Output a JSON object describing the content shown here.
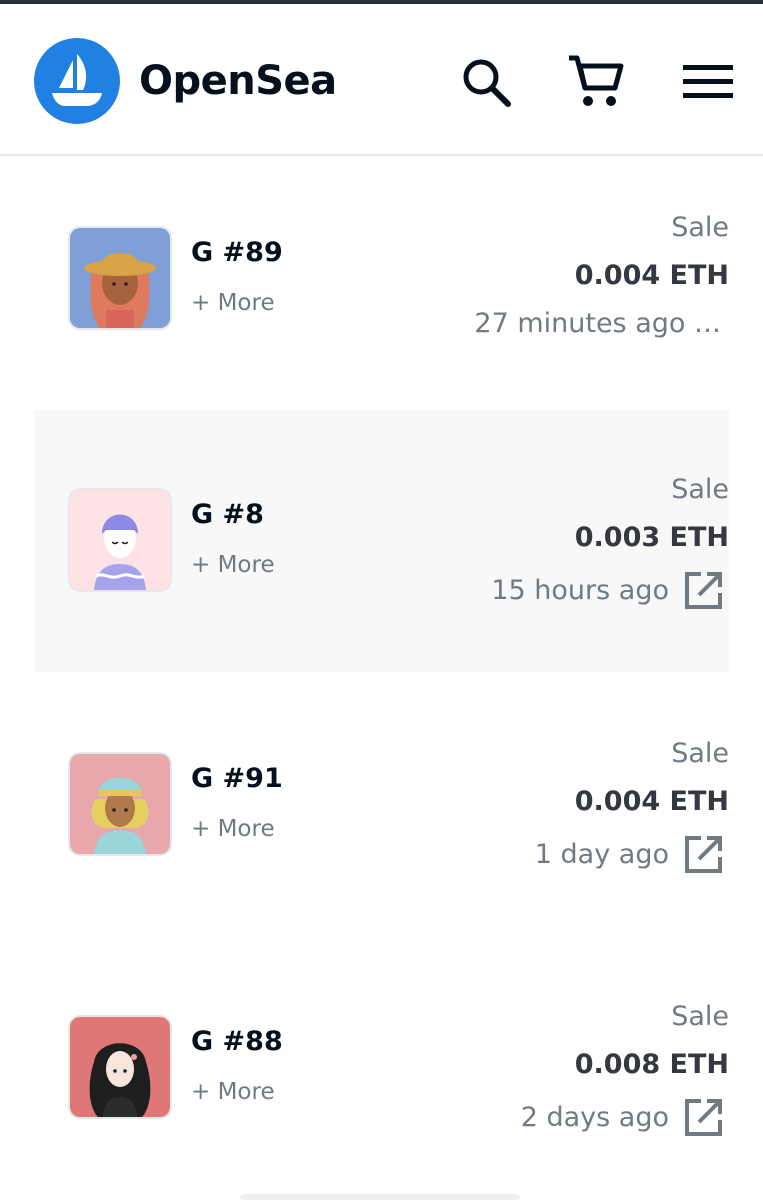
{
  "header": {
    "brand": "OpenSea",
    "icons": [
      "opensea-logo-icon",
      "search-icon",
      "cart-icon",
      "menu-icon"
    ]
  },
  "activity": [
    {
      "name": "G #89",
      "more": "+ More",
      "event": "Sale",
      "price": "0.004 ETH",
      "time": "27 minutes ago …",
      "link_icon": false
    },
    {
      "name": "G #8",
      "more": "+ More",
      "event": "Sale",
      "price": "0.003 ETH",
      "time": "15 hours ago",
      "link_icon": true
    },
    {
      "name": "G #91",
      "more": "+ More",
      "event": "Sale",
      "price": "0.004 ETH",
      "time": "1 day ago",
      "link_icon": true
    },
    {
      "name": "G #88",
      "more": "+ More",
      "event": "Sale",
      "price": "0.008 ETH",
      "time": "2 days ago",
      "link_icon": true
    }
  ],
  "colors": {
    "brand_blue": "#2081e2",
    "text_dark": "#04111d",
    "text_muted": "#707a83",
    "row_highlight": "#f8f8f8"
  }
}
